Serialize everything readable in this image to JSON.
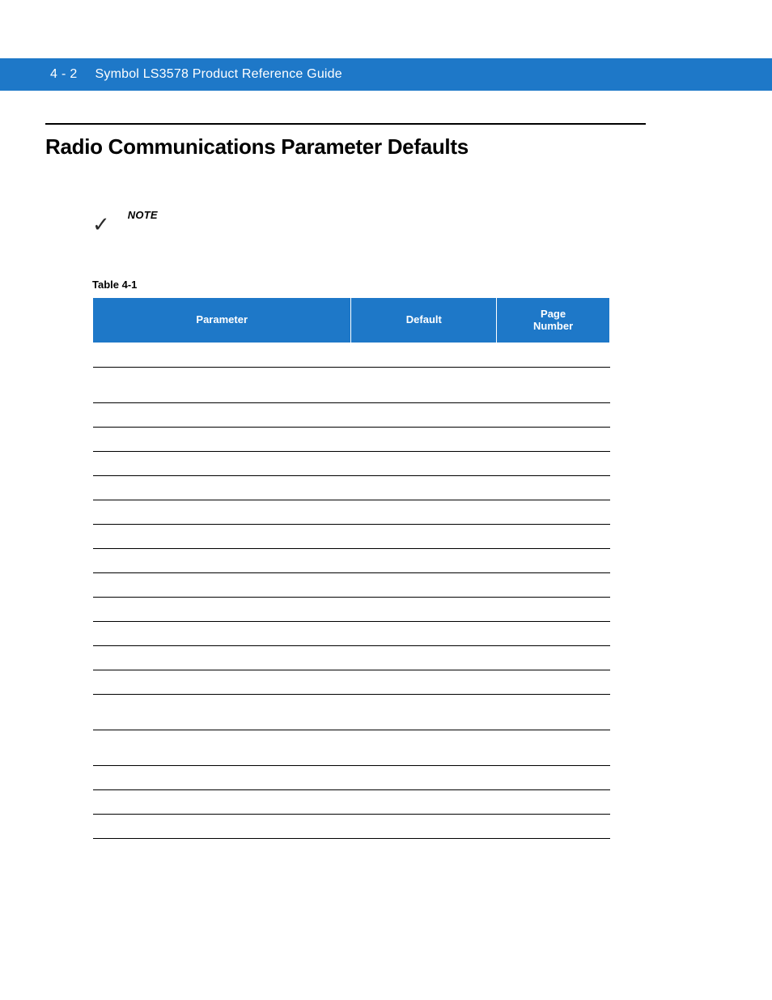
{
  "header": {
    "page_number": "4 - 2",
    "doc_title": "Symbol LS3578 Product Reference Guide"
  },
  "section": {
    "heading": "Radio Communications Parameter Defaults"
  },
  "note": {
    "label": "NOTE",
    "icon": "checkmark-icon"
  },
  "table": {
    "caption": "Table 4-1",
    "columns": {
      "parameter": "Parameter",
      "default": "Default",
      "page_number_line1": "Page",
      "page_number_line2": "Number"
    },
    "rows": [
      {
        "parameter": "",
        "default": "",
        "page": "",
        "height": "small"
      },
      {
        "parameter": "",
        "default": "",
        "page": "",
        "height": "med"
      },
      {
        "parameter": "",
        "default": "",
        "page": "",
        "height": "small"
      },
      {
        "parameter": "",
        "default": "",
        "page": "",
        "height": "small"
      },
      {
        "parameter": "",
        "default": "",
        "page": "",
        "height": "small"
      },
      {
        "parameter": "",
        "default": "",
        "page": "",
        "height": "small"
      },
      {
        "parameter": "",
        "default": "",
        "page": "",
        "height": "small"
      },
      {
        "parameter": "",
        "default": "",
        "page": "",
        "height": "small"
      },
      {
        "parameter": "",
        "default": "",
        "page": "",
        "height": "small"
      },
      {
        "parameter": "",
        "default": "",
        "page": "",
        "height": "small"
      },
      {
        "parameter": "",
        "default": "",
        "page": "",
        "height": "small"
      },
      {
        "parameter": "",
        "default": "",
        "page": "",
        "height": "small"
      },
      {
        "parameter": "",
        "default": "",
        "page": "",
        "height": "small"
      },
      {
        "parameter": "",
        "default": "",
        "page": "",
        "height": "small"
      },
      {
        "parameter": "",
        "default": "",
        "page": "",
        "height": "med"
      },
      {
        "parameter": "",
        "default": "",
        "page": "",
        "height": "med"
      },
      {
        "parameter": "",
        "default": "",
        "page": "",
        "height": "small"
      },
      {
        "parameter": "",
        "default": "",
        "page": "",
        "height": "small"
      },
      {
        "parameter": "",
        "default": "",
        "page": "",
        "height": "small"
      },
      {
        "parameter": "",
        "default": "",
        "page": "",
        "height": "small"
      }
    ]
  }
}
